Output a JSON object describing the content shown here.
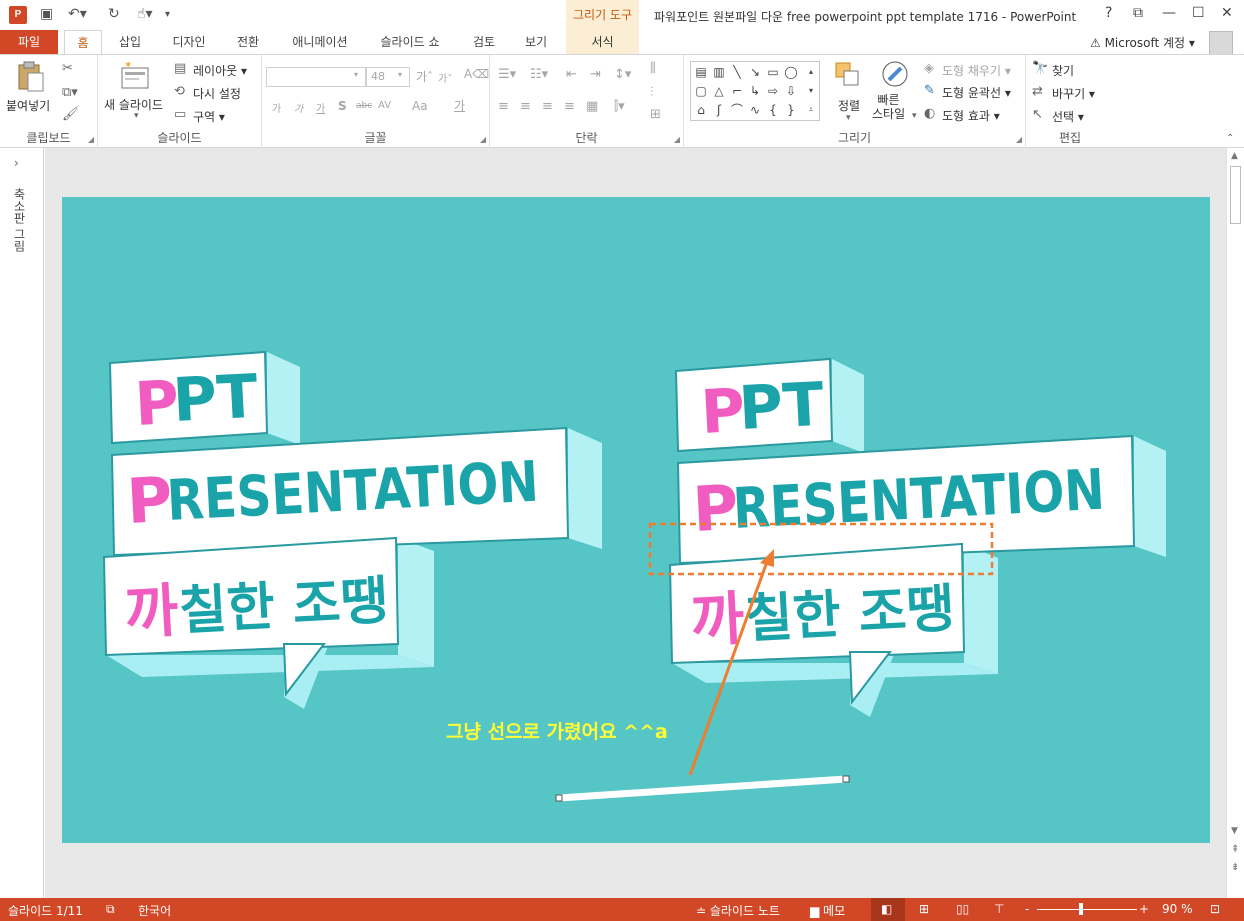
{
  "titlebar": {
    "app_logo": "P",
    "context_tab": "그리기 도구",
    "title": "파워포인트 원본파일 다운 free powerpoint ppt template 1716 - PowerPoint",
    "help": "?",
    "restore_ribbon": "⧉",
    "minimize": "—",
    "maximize": "☐",
    "close": "✕",
    "icons": [
      "save-icon",
      "undo-icon",
      "redo-icon",
      "touch-mode-icon",
      "customize-qat-icon"
    ]
  },
  "tabs": {
    "file": "파일",
    "items": [
      "홈",
      "삽입",
      "디자인",
      "전환",
      "애니메이션",
      "슬라이드 쇼",
      "검토",
      "보기",
      "서식"
    ],
    "active": "홈",
    "account": "⚠ Microsoft 계정 ▾"
  },
  "ribbon": {
    "clipboard": {
      "label": "클립보드",
      "paste": "붙여넣기"
    },
    "slides": {
      "label": "슬라이드",
      "new_slide": "새 슬라이드",
      "layout": "레이아웃 ▾",
      "reset": "다시 설정",
      "section": "구역 ▾"
    },
    "font": {
      "label": "글꼴",
      "font_name": "",
      "font_size": "48",
      "bold": "가",
      "italic": "가",
      "underline": "가",
      "shadow": "S",
      "strike": "abc",
      "spacing": "AV",
      "case": "Aa",
      "color": "가"
    },
    "paragraph": {
      "label": "단락"
    },
    "drawing": {
      "label": "그리기",
      "arrange": "정렬",
      "quick_styles": "빠른\n스타일",
      "shape_fill": "도형 채우기 ▾",
      "shape_outline": "도형 윤곽선 ▾",
      "shape_effects": "도형 효과 ▾"
    },
    "editing": {
      "label": "편집",
      "find": "찾기",
      "replace": "바꾸기 ▾",
      "select": "선택 ▾"
    }
  },
  "thumbpane": {
    "label": "축소판 그림"
  },
  "slide": {
    "callout_left": {
      "line1_first": "P",
      "line1_rest": "PT",
      "line2_first": "P",
      "line2_rest": "RESENTATION",
      "line3_first": "까",
      "line3_rest": "칠한 조땡"
    },
    "callout_right": {
      "line1_first": "P",
      "line1_rest": "PT",
      "line2_first": "P",
      "line2_rest": "RESENTATION",
      "line3_first": "까",
      "line3_rest": "칠한 조땡"
    },
    "annotation": "그냥 선으로 가렸어요 ^^a"
  },
  "statusbar": {
    "slide_counter": "슬라이드 1/11",
    "spell_icon": "spell-check-icon",
    "language": "한국어",
    "notes": "≐ 슬라이드 노트",
    "comments": "▆ 메모",
    "zoom": "90 %",
    "zoom_minus": "-",
    "zoom_plus": "+"
  },
  "colors": {
    "accent": "#d24726",
    "slide_bg": "#55c5c5",
    "teal_text": "#1aa3a9",
    "pink_text": "#f05cbf",
    "annotation_text": "#ffff33",
    "dashed_box": "#ed7d31"
  }
}
